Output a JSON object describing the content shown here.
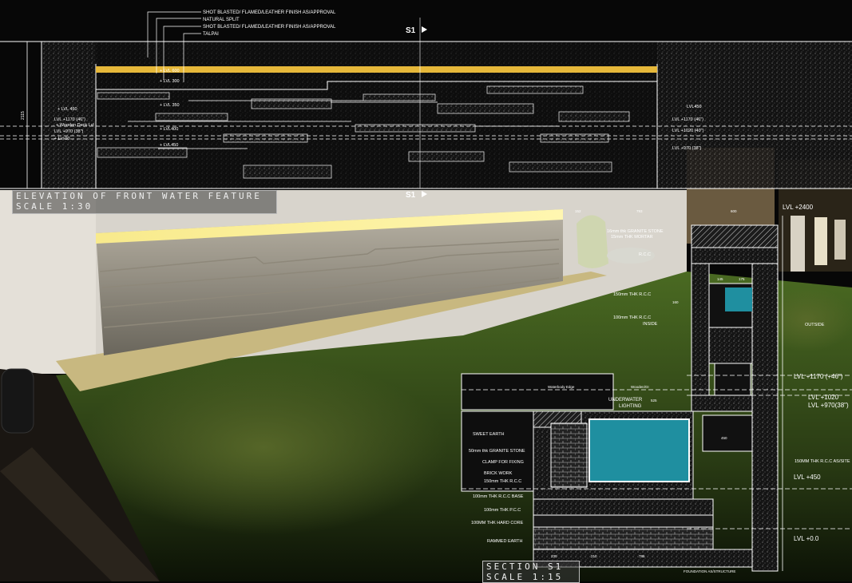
{
  "elevation": {
    "notes": [
      "SHOT BLASTED/ FLAMED/LEATHER FINISH AS/APPROVAL",
      "NATURAL SPLIT",
      "SHOT BLASTED/ FLAMED/LEATHER FINISH AS/APPROVAL",
      "TALPAI"
    ],
    "section_marker": "S1",
    "levels_left": [
      "+ LVL 600",
      "+ LVL 300",
      "+ LVL 350",
      "+ LVL 450",
      "LVL +1170 (46\")",
      "+ Wooden Deck Lvl",
      "LVL +970 (38\")",
      "+ LVL400",
      "+ LVL450",
      "+ Lvl 00"
    ],
    "levels_right": [
      "LVL450",
      "LVL +1170 (46\")",
      "LVL +1020 (40\")",
      "LVL +970 (38\")"
    ],
    "dimension": "2115",
    "title": "ELEVATION OF FRONT WATER FEATURE",
    "scale": "SCALE 1:30"
  },
  "section": {
    "labels_upper": [
      "16mm thk GRANITE STONE",
      "15mm THK MORTAR",
      "R.C.C",
      "150mm THK R.C.C",
      "100mm THK R.C.C",
      "INSIDE",
      "OUTSIDE"
    ],
    "labels_lower": [
      "UNDERWATER",
      "LIGHTING",
      "Waterbody Edge",
      "Wooden/GI"
    ],
    "labels_left": [
      "SWEET EARTH",
      "50mm thk GRANITE STONE",
      "CLAMP FOR FIXING",
      "BRICK WORK",
      "150mm THK R.C.C",
      "100mm THK R.C.C BASE",
      "100mm THK P.C.C",
      "100MM THK HARD CORE",
      "RAMMED EARTH"
    ],
    "levels": [
      "LVL +2400",
      "LVL +1170 (+46\")",
      "LVL +1020",
      "LVL +970(38\")",
      "LVL +450",
      "LVL +0.0"
    ],
    "right_note": "150MM THK R.C.C AS/SITE",
    "foundation": "FOUNDATION AS/STRUCTURE",
    "dims_top": [
      "152",
      "793",
      "600"
    ],
    "dims_mid": [
      "145",
      "175",
      "160",
      "525",
      "450"
    ],
    "dims_bottom": [
      "230",
      "210",
      "785"
    ],
    "title": "SECTION S1",
    "scale": "SCALE 1:15"
  },
  "colors": {
    "glow": "#f4e07a",
    "water": "#1f8fa0",
    "grass": "#3a5a1e",
    "line": "#ffffff"
  }
}
